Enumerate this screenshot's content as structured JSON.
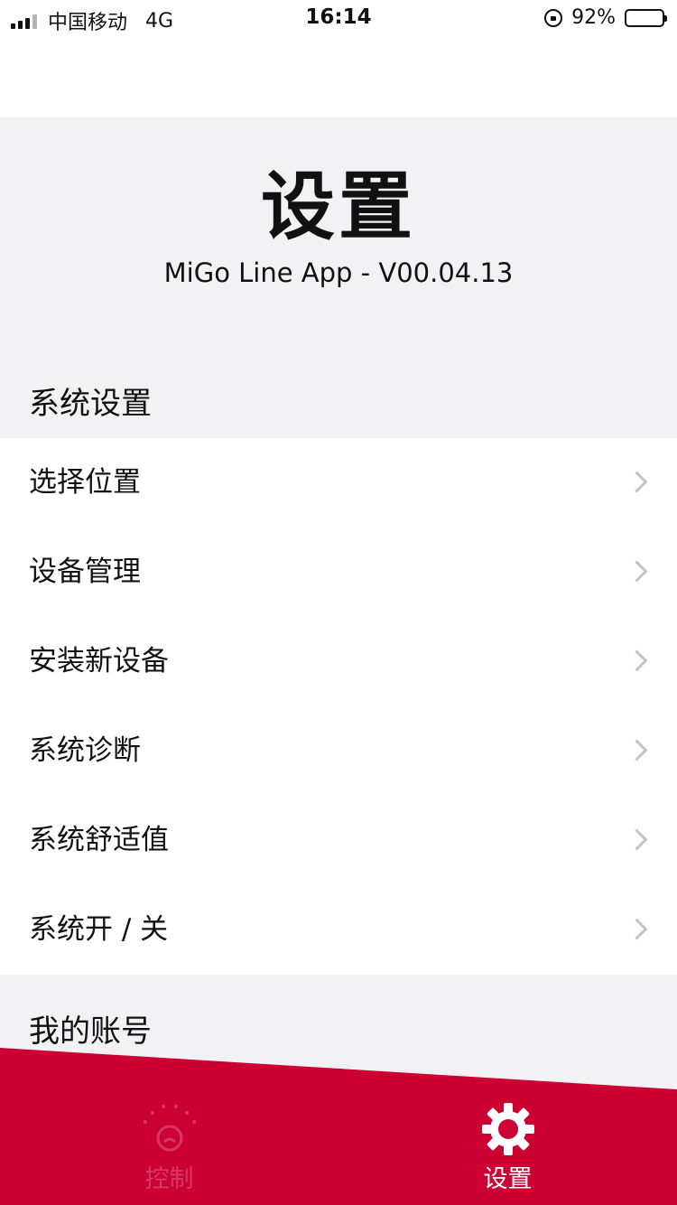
{
  "status_bar": {
    "carrier": "中国移动",
    "network": "4G",
    "time": "16:14",
    "battery": "92%",
    "battery_level": 0.92
  },
  "header": {
    "title": "设置",
    "version": "MiGo Line App - V00.04.13"
  },
  "system_section": {
    "title": "系统设置",
    "items": [
      {
        "label": "选择位置"
      },
      {
        "label": "设备管理"
      },
      {
        "label": "安装新设备"
      },
      {
        "label": "系统诊断"
      },
      {
        "label": "系统舒适值"
      },
      {
        "label": "系统开 / 关"
      }
    ]
  },
  "account_section": {
    "title": "我的账号"
  },
  "tab_bar": {
    "tabs": [
      {
        "label": "控制",
        "icon": "thermostat-icon",
        "active": false
      },
      {
        "label": "设置",
        "icon": "gear-icon",
        "active": true
      }
    ],
    "color": "#cc0033"
  }
}
